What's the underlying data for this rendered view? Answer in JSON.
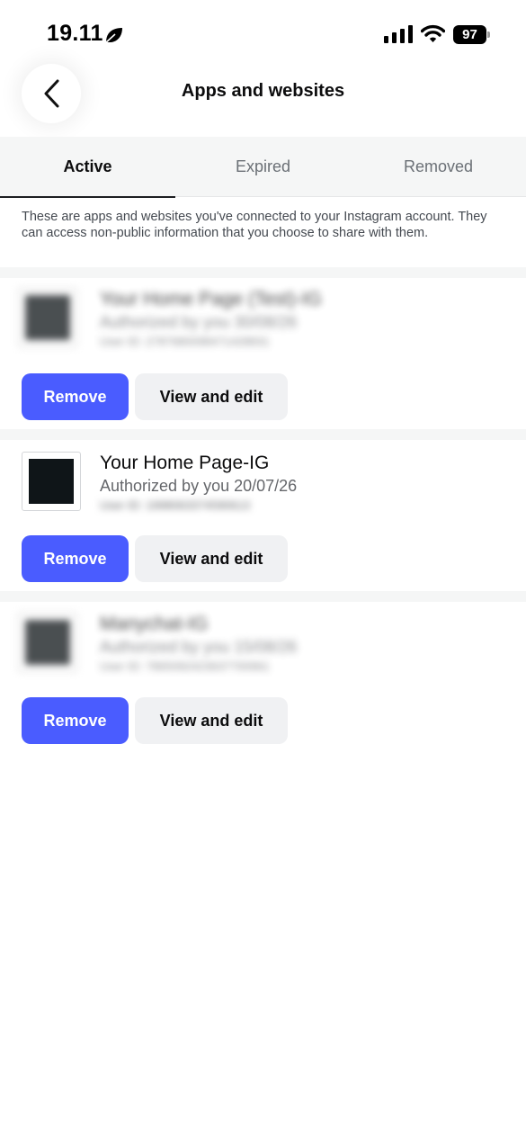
{
  "status_bar": {
    "time": "19.11",
    "battery": "97"
  },
  "header": {
    "title": "Apps and websites",
    "back_icon": "chevron-left-icon"
  },
  "tabs": [
    {
      "label": "Active",
      "selected": true
    },
    {
      "label": "Expired",
      "selected": false
    },
    {
      "label": "Removed",
      "selected": false
    }
  ],
  "description": "These are apps and websites you've connected to your Instagram account. They can access non-public information that you choose to share with them.",
  "apps": [
    {
      "name": "Your Home Page (Test)-IG",
      "authorized": "Authorized by you 30/08/26",
      "user_id": "User ID: 2787680098471428831",
      "blurred": true,
      "remove_label": "Remove",
      "view_label": "View and edit"
    },
    {
      "name": "Your Home Page-IG",
      "authorized": "Authorized by you 20/07/26",
      "user_id": "User ID: 1998063374590613",
      "blurred": false,
      "remove_label": "Remove",
      "view_label": "View and edit"
    },
    {
      "name": "Manychat-IG",
      "authorized": "Authorized by you 15/08/26",
      "user_id": "User ID: 7865092423637700961",
      "blurred": true,
      "remove_label": "Remove",
      "view_label": "View and edit"
    }
  ],
  "colors": {
    "primary_button": "#4a5cff",
    "secondary_button": "#f0f1f3",
    "tab_background": "#f5f6f6"
  }
}
